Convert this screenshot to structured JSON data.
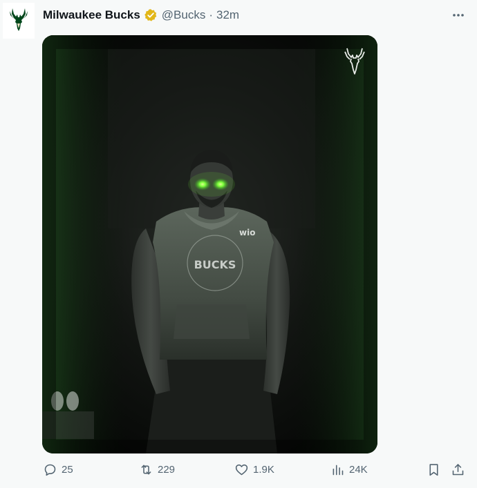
{
  "tweet": {
    "author_name": "Milwaukee Bucks",
    "handle": "@Bucks",
    "separator": "·",
    "time": "32m",
    "verified_icon": "verified-badge-icon",
    "more_icon": "more-options-icon"
  },
  "media": {
    "jersey_text": "BUCKS",
    "sponsor_text": "wio"
  },
  "actions": {
    "replies": "25",
    "reposts": "229",
    "likes": "1.9K",
    "views": "24K"
  },
  "colors": {
    "accent_green": "#00471b",
    "glow_green": "#7dff3c",
    "text_secondary": "#536471",
    "verified_gold": "#e2b719"
  }
}
